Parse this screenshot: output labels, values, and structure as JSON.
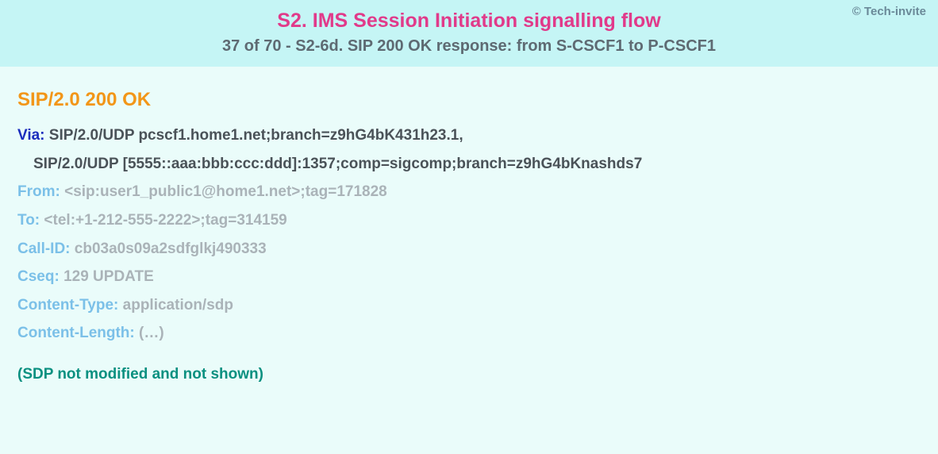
{
  "copyright": "© Tech-invite",
  "title": "S2. IMS Session Initiation signalling flow",
  "subtitle": "37 of 70 - S2-6d. SIP 200 OK response: from S-CSCF1 to P-CSCF1",
  "response_line": "SIP/2.0 200 OK",
  "headers": {
    "via": {
      "name": "Via:",
      "value1": "SIP/2.0/UDP pcscf1.home1.net;branch=z9hG4bK431h23.1,",
      "value2": "SIP/2.0/UDP [5555::aaa:bbb:ccc:ddd]:1357;comp=sigcomp;branch=z9hG4bKnashds7"
    },
    "from": {
      "name": "From:",
      "value": "<sip:user1_public1@home1.net>;tag=171828"
    },
    "to": {
      "name": "To:",
      "value": "<tel:+1-212-555-2222>;tag=314159"
    },
    "call_id": {
      "name": "Call-ID:",
      "value": "cb03a0s09a2sdfglkj490333"
    },
    "cseq": {
      "name": "Cseq:",
      "value": "129 UPDATE"
    },
    "content_type": {
      "name": "Content-Type:",
      "value": "application/sdp"
    },
    "content_length": {
      "name": "Content-Length:",
      "value": "(…)"
    }
  },
  "sdp_note": "(SDP not modified and not shown)"
}
